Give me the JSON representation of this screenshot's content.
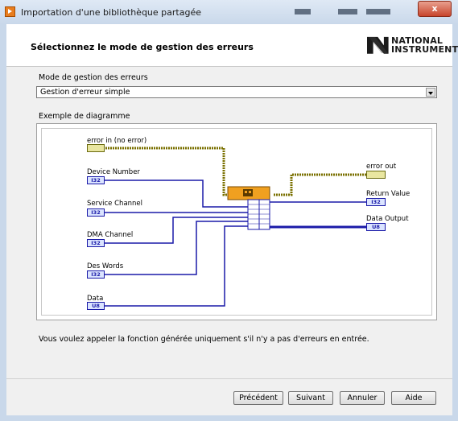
{
  "window": {
    "title": "Importation d'une bibliothèque partagée",
    "close_label": "x"
  },
  "header": {
    "title": "Sélectionnez le mode de gestion des erreurs",
    "logo_line1": "NATIONAL",
    "logo_line2": "INSTRUMENTS"
  },
  "error_mode": {
    "label": "Mode de gestion des erreurs",
    "selected": "Gestion d'erreur simple"
  },
  "diagram": {
    "label": "Exemple de diagramme",
    "inputs": [
      {
        "label": "error in (no error)",
        "type": "error"
      },
      {
        "label": "Device Number",
        "type": "I32"
      },
      {
        "label": "Service Channel",
        "type": "I32"
      },
      {
        "label": "DMA Channel",
        "type": "I32"
      },
      {
        "label": "Des Words",
        "type": "I32"
      },
      {
        "label": "Data",
        "type": "U8"
      }
    ],
    "outputs": [
      {
        "label": "error out",
        "type": "error"
      },
      {
        "label": "Return Value",
        "type": "I32"
      },
      {
        "label": "Data Output",
        "type": "U8"
      }
    ]
  },
  "description": "Vous voulez appeler la fonction générée uniquement s'il n'y a pas d'erreurs en entrée.",
  "buttons": {
    "previous": "Précédent",
    "next": "Suivant",
    "cancel": "Annuler",
    "help": "Aide"
  },
  "colors": {
    "wire_blue": "#1a1aa8",
    "wire_error": "#7a7000",
    "node_orange": "#f0a020"
  }
}
